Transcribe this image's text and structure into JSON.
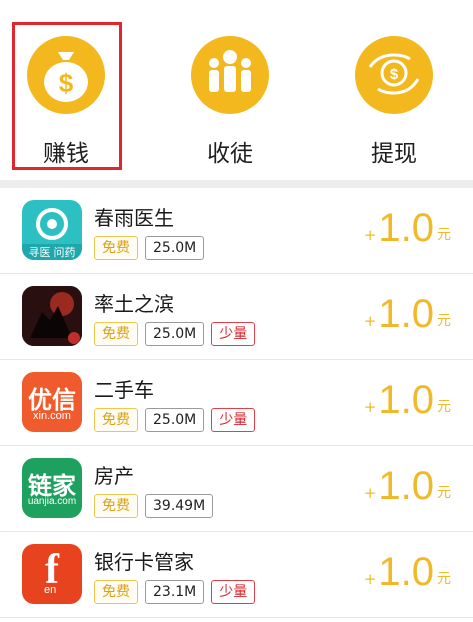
{
  "actions": [
    {
      "label": "赚钱",
      "icon": "money-bag-icon"
    },
    {
      "label": "收徒",
      "icon": "people-group-icon"
    },
    {
      "label": "提现",
      "icon": "cash-hand-icon"
    }
  ],
  "apps": [
    {
      "name": "春雨医生",
      "tags": {
        "free": "免费",
        "size": "25.0M",
        "few": ""
      },
      "reward": {
        "plus": "+",
        "amount": "1.0",
        "unit": "元"
      },
      "icon": "chunyu-icon",
      "icon_text": "寻医 问药",
      "icon_color": "#2cc0c3"
    },
    {
      "name": "率土之滨",
      "tags": {
        "free": "免费",
        "size": "25.0M",
        "few": "少量"
      },
      "reward": {
        "plus": "+",
        "amount": "1.0",
        "unit": "元"
      },
      "icon": "game-icon",
      "icon_text": "",
      "icon_color": "#4a1c1c"
    },
    {
      "name": "二手车",
      "tags": {
        "free": "免费",
        "size": "25.0M",
        "few": "少量"
      },
      "reward": {
        "plus": "+",
        "amount": "1.0",
        "unit": "元"
      },
      "icon": "youxin-icon",
      "icon_text": "优信",
      "icon_sub": "xin.com",
      "icon_color": "#ef5b2c"
    },
    {
      "name": "房产",
      "tags": {
        "free": "免费",
        "size": "39.49M",
        "few": ""
      },
      "reward": {
        "plus": "+",
        "amount": "1.0",
        "unit": "元"
      },
      "icon": "lianjia-icon",
      "icon_text": "链家",
      "icon_sub": "uanjia.com",
      "icon_color": "#1ea05f"
    },
    {
      "name": "银行卡管家",
      "tags": {
        "free": "免费",
        "size": "23.1M",
        "few": "少量"
      },
      "reward": {
        "plus": "+",
        "amount": "1.0",
        "unit": "元"
      },
      "icon": "fen-icon",
      "icon_text": "f",
      "icon_sub": "en",
      "icon_color": "#e8431f"
    }
  ],
  "colors": {
    "accent": "#f2b81d",
    "selection": "#e2262e"
  }
}
